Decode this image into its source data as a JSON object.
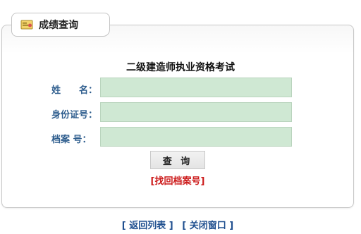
{
  "tab": {
    "title": "成绩查询",
    "icon": "certificate-icon"
  },
  "form": {
    "heading": "二级建造师执业资格考试",
    "name_label": "姓　　名：",
    "id_label": "身份证号：",
    "file_label": "档案 号：",
    "name_value": "",
    "id_value": "",
    "file_value": "",
    "submit_label": "查 询",
    "recover_link": "[找回档案号]"
  },
  "footer": {
    "back_link": "[ 返回列表 ]",
    "close_link": "[ 关闭窗口 ]"
  },
  "colors": {
    "field_bg": "#cfe8d3",
    "label": "#2f5e8e",
    "recover": "#cc1a1a",
    "footer_link": "#1f4f8f"
  }
}
